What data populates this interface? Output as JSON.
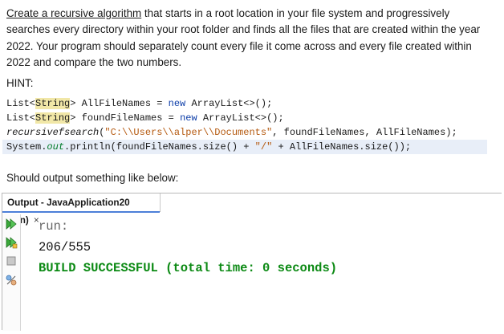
{
  "intro": {
    "link_text": "Create a recursive algorithm",
    "text_after_link": " that starts in a root location in your file system and progressively searches every directory within your root folder and finds all the files that are created within the year 2022. Your program should separately count every file it come across and every file created within 2022 and compare the two numbers."
  },
  "hint_label": "HINT:",
  "code": {
    "line1": {
      "t1": "List<",
      "t2": "String",
      "t3": "> AllFileNames = ",
      "t4": "new",
      "t5": " ArrayList<>();"
    },
    "line2": {
      "t1": "List<",
      "t2": "String",
      "t3": "> foundFileNames = ",
      "t4": "new",
      "t5": " ArrayList<>();"
    },
    "line3": {
      "t1": "recursivefsearch",
      "t2": "(",
      "t3": "\"C:\\\\Users\\\\alper\\\\Documents\"",
      "t4": ", foundFileNames, AllFileNames);"
    },
    "line4": {
      "t1": "System.",
      "t2": "out",
      "t3": ".println(foundFileNames.size() + ",
      "t4": "\"/\"",
      "t5": " + AllFileNames.size());"
    }
  },
  "should_text": "Should output something like below:",
  "output_panel": {
    "tab_title": "Output - JavaApplication20 (run)",
    "close_glyph": "×",
    "lines": {
      "run": "run:",
      "result": "206/555",
      "build": "BUILD SUCCESSFUL (total time: 0 seconds)"
    },
    "icons": [
      "rerun-icon",
      "rerun-with-arguments-icon",
      "stop-icon",
      "settings-icon"
    ]
  }
}
